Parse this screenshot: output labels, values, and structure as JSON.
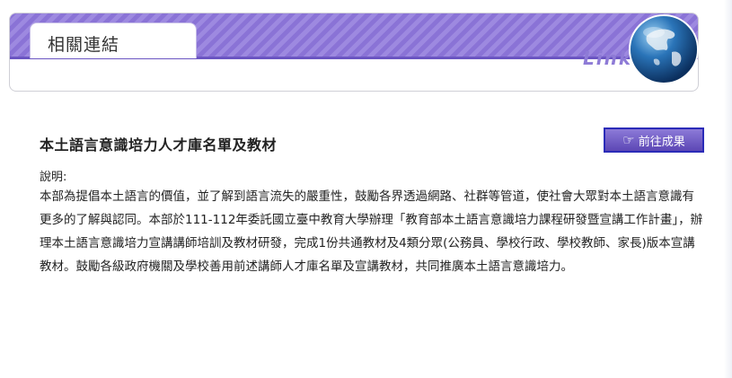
{
  "banner": {
    "title": "相關連結",
    "decor_text": "Link",
    "accent_color": "#8a73d6"
  },
  "section": {
    "title": "本土語言意識培力人才庫名單及教材",
    "button_label": "前往成果",
    "button_icon": "pointing-hand-icon",
    "description_label": "說明:",
    "description": "本部為提倡本土語言的價值，並了解到語言流失的嚴重性，鼓勵各界透過網路、社群等管道，使社會大眾對本土語言意識有更多的了解與認同。本部於111-112年委託國立臺中教育大學辦理「教育部本土語言意識培力課程研發暨宣講工作計畫」，辦理本土語言意識培力宣講講師培訓及教材研發，完成1份共通教材及4類分眾(公務員、學校行政、學校教師、家長)版本宣講教材。鼓勵各級政府機關及學校善用前述講師人才庫名單及宣講教材，共同推廣本土語言意識培力。"
  }
}
